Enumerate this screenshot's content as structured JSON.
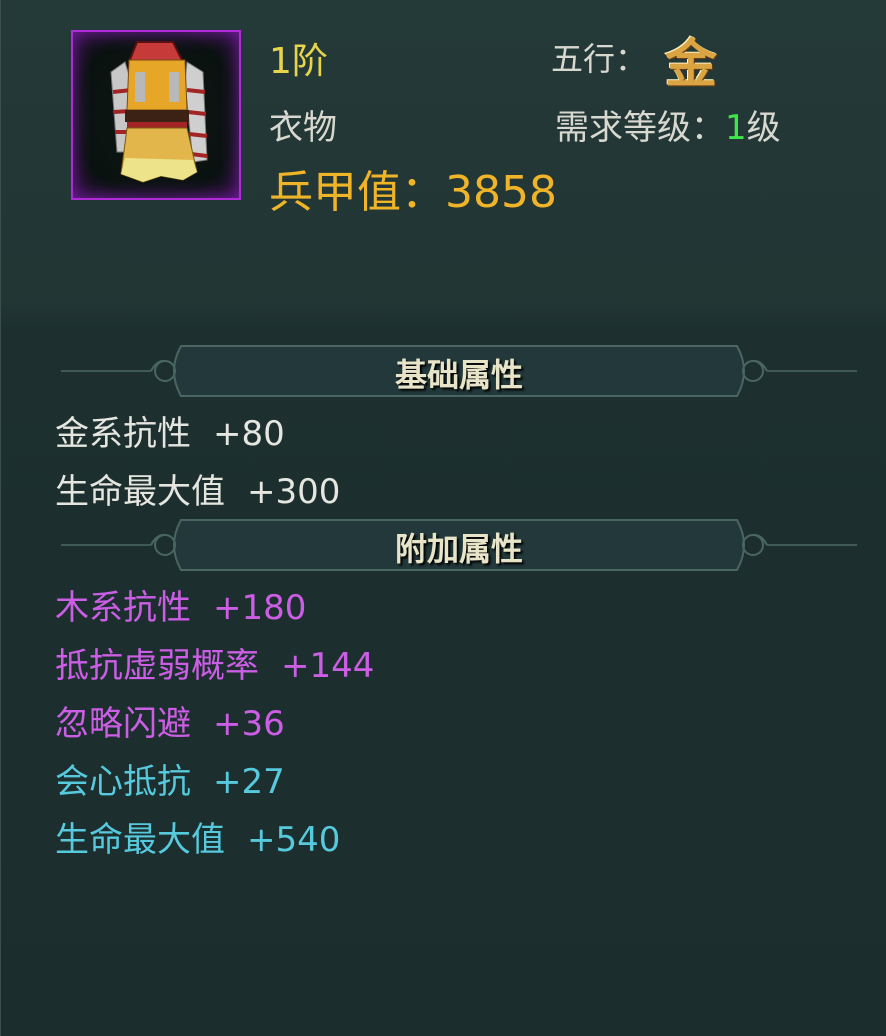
{
  "item": {
    "icon": "robe-armor-icon",
    "tier": "1阶",
    "type": "衣物",
    "armor_label": "兵甲值：",
    "armor_value": "3858",
    "element_label": "五行：",
    "element_value": "金",
    "req_label": "需求等级：",
    "req_value": "1",
    "req_unit": "级"
  },
  "sections": {
    "base_title": "基础属性",
    "extra_title": "附加属性"
  },
  "base_stats": [
    {
      "name": "金系抗性",
      "value": "+80"
    },
    {
      "name": "生命最大值",
      "value": "+300"
    }
  ],
  "extra_stats": [
    {
      "name": "木系抗性",
      "value": "+180"
    },
    {
      "name": "抵抗虚弱概率",
      "value": "+144"
    },
    {
      "name": "忽略闪避",
      "value": "+36"
    },
    {
      "name": "会心抵抗",
      "value": "+27"
    },
    {
      "name": "生命最大值",
      "value": "+540"
    }
  ],
  "colors": {
    "tier": "#e7d44a",
    "armor": "#f0b429",
    "base_stat": "#e6e6e0",
    "extra_stat_purple": "#cc5ee6",
    "extra_stat_cyan": "#57c9dd",
    "required_level": "#3ee64a",
    "frame_border": "#b02ad8"
  }
}
